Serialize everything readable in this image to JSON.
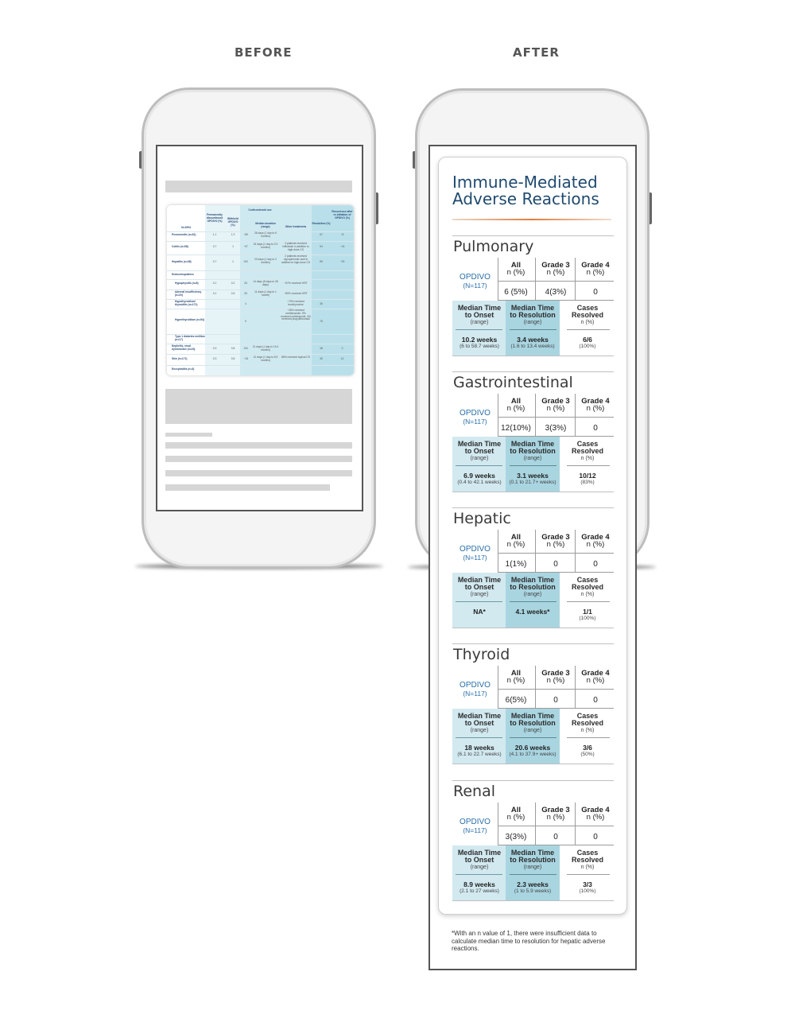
{
  "labels": {
    "before": "BEFORE",
    "after": "AFTER"
  },
  "before_table": {
    "headers": [
      "N=1994",
      "Permanently discontinued OPDIVO (%)",
      "Withheld OPDIVO (%)",
      "Corticosteroid use",
      "Median duration (range)",
      "Other treatments",
      "Resolution (%)",
      "Recurrence after re-initiation of OPDIVO (%)"
    ],
    "rows": [
      {
        "label": "Pneumonitis (n=61)",
        "cells": [
          "1.1",
          "1.3",
          "~89",
          "26 days (1 day to 6 months)",
          "",
          "67",
          "~8"
        ]
      },
      {
        "label": "Colitis (n=58)",
        "cells": [
          "0.7",
          "1",
          "~97",
          "23 days (1 day to 9.3 months)",
          "4 patients received infliximab in addition to high-dose CS",
          "94",
          "~16"
        ]
      },
      {
        "label": "Hepatitis (n=38)",
        "cells": [
          "0.7",
          "1",
          "100",
          "23 days (1 day to 2 months)",
          "2 patients received mycophenolic acid in addition to high-dose CS",
          "89",
          "~29"
        ]
      },
      {
        "label": "Endocrinopathies",
        "cells": [
          "",
          "",
          "",
          "",
          "",
          "",
          ""
        ]
      },
      {
        "label": "Hypophysitis (n=8)",
        "cells": [
          "0.1",
          "0.2",
          "25",
          "14 days (5 days to 26 days)",
          "~67% received HRT",
          "",
          ""
        ]
      },
      {
        "label": "Adrenal insufficiency (n=20)",
        "cells": [
          "0.1",
          "0.5",
          "25",
          "11 days (1 day to 1 month)",
          "~80% received HRT",
          "",
          ""
        ]
      },
      {
        "label": "Hypothyroidism/ thyroiditis (n=171)",
        "cells": [
          "",
          "",
          "4",
          "",
          "~79% received levothyroxine",
          "35",
          ""
        ]
      },
      {
        "label": "Hyperthyroidism (n=54)",
        "cells": [
          "",
          "",
          "9",
          "",
          "~26% received methimazole, 9% received carbimazole, 4% received propylthiouracil",
          "76",
          ""
        ]
      },
      {
        "label": "Type 1 diabetes mellitus (n=17)",
        "cells": [
          "",
          "",
          "",
          "",
          "",
          "",
          ""
        ]
      },
      {
        "label": "Nephritis, renal dysfunction (n=23)",
        "cells": [
          "0.3",
          "0.8",
          "100",
          "21 days (1 day to 15.4 months)",
          "",
          "48",
          "0"
        ]
      },
      {
        "label": "Skin (n=171)",
        "cells": [
          "0.3",
          "0.8",
          "~18",
          "12 days (1 day to 8.9 months)",
          "85% received topical CS",
          "49",
          "14"
        ]
      },
      {
        "label": "Encephalitis (n=3)",
        "cells": [
          "",
          "",
          "",
          "",
          "",
          "",
          ""
        ]
      }
    ]
  },
  "card": {
    "title_line1": "Immune-Mediated",
    "title_line2": "Adverse Reactions",
    "opdivo_label": "OPDIVO",
    "opdivo_n": "(N=117)",
    "grade_headers": [
      {
        "top": "All",
        "bottom": "n (%)"
      },
      {
        "top": "Grade 3",
        "bottom": "n (%)"
      },
      {
        "top": "Grade 4",
        "bottom": "n (%)"
      }
    ],
    "metric_headers": [
      {
        "line1": "Median Time",
        "line2": "to Onset",
        "sub": "(range)"
      },
      {
        "line1": "Median Time",
        "line2": "to Resolution",
        "sub": "(range)"
      },
      {
        "line1": "Cases",
        "line2": "Resolved",
        "sub": "n (%)"
      }
    ],
    "sections": [
      {
        "name": "Pulmonary",
        "grades": [
          "6 (5%)",
          "4(3%)",
          "0"
        ],
        "onset": "10.2 weeks",
        "onset_range": "(6 to 58.7 weeks)",
        "resolution": "3.4 weeks",
        "resolution_range": "(1.6 to 13.4 weeks)",
        "resolved": "6/6",
        "resolved_pct": "(100%)"
      },
      {
        "name": "Gastrointestinal",
        "grades": [
          "12(10%)",
          "3(3%)",
          "0"
        ],
        "onset": "6.9 weeks",
        "onset_range": "(0.4 to 42.1 weeks)",
        "resolution": "3.1 weeks",
        "resolution_range": "(0.1 to 21.7+ weeks)",
        "resolved": "10/12",
        "resolved_pct": "(83%)"
      },
      {
        "name": "Hepatic",
        "grades": [
          "1(1%)",
          "0",
          "0"
        ],
        "onset": "NA*",
        "onset_range": "",
        "resolution": "4.1 weeks*",
        "resolution_range": "",
        "resolved": "1/1",
        "resolved_pct": "(100%)"
      },
      {
        "name": "Thyroid",
        "grades": [
          "6(5%)",
          "0",
          "0"
        ],
        "onset": "18 weeks",
        "onset_range": "(6.1 to 22.7 weeks)",
        "resolution": "20.6 weeks",
        "resolution_range": "(4.1 to 37.9+ weeks)",
        "resolved": "3/6",
        "resolved_pct": "(50%)"
      },
      {
        "name": "Renal",
        "grades": [
          "3(3%)",
          "0",
          "0"
        ],
        "onset": "8.9 weeks",
        "onset_range": "(2.1 to 27 weeks)",
        "resolution": "2.3 weeks",
        "resolution_range": "(1 to 5.9 weeks)",
        "resolved": "3/3",
        "resolved_pct": "(100%)"
      }
    ],
    "footnote": "*With an n value of 1, there were insufficient data to calculate median time to resolution for hepatic adverse reactions."
  },
  "colors": {
    "title_blue": "#1f4a6f",
    "opdivo_blue": "#2a6fa8",
    "onset_bg": "#d2e9f0",
    "resolution_bg": "#a9d5e1",
    "accent_orange": "#e37b3c"
  }
}
